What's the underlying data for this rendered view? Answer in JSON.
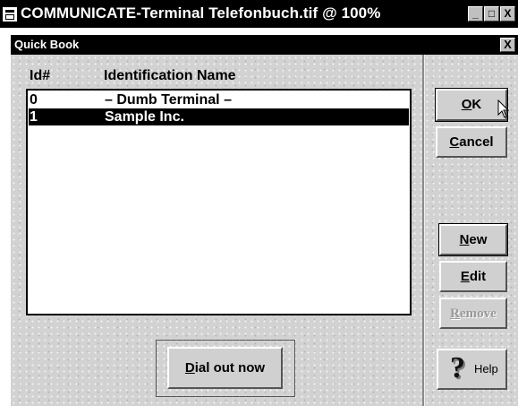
{
  "window": {
    "title": "COMMUNICATE-Terminal Telefonbuch.tif @ 100%",
    "buttons": {
      "minimize": "_",
      "maximize": "□",
      "close": "X"
    }
  },
  "dialog": {
    "title": "Quick Book",
    "close": "X",
    "columns": {
      "id": "Id#",
      "name": "Identification Name"
    },
    "rows": [
      {
        "id": "0",
        "name": "– Dumb Terminal –",
        "selected": false
      },
      {
        "id": "1",
        "name": "Sample Inc.",
        "selected": true
      }
    ],
    "buttons": {
      "ok": {
        "hotkey": "O",
        "rest": "K"
      },
      "cancel": {
        "hotkey": "C",
        "rest": "ancel"
      },
      "new": {
        "hotkey": "N",
        "rest": "ew"
      },
      "edit": {
        "hotkey": "E",
        "rest": "dit"
      },
      "remove": {
        "hotkey": "R",
        "rest": "emove"
      },
      "help": "Help",
      "help_icon_glyph": "?",
      "dial": {
        "hotkey": "D",
        "rest": "ial out now"
      }
    }
  }
}
